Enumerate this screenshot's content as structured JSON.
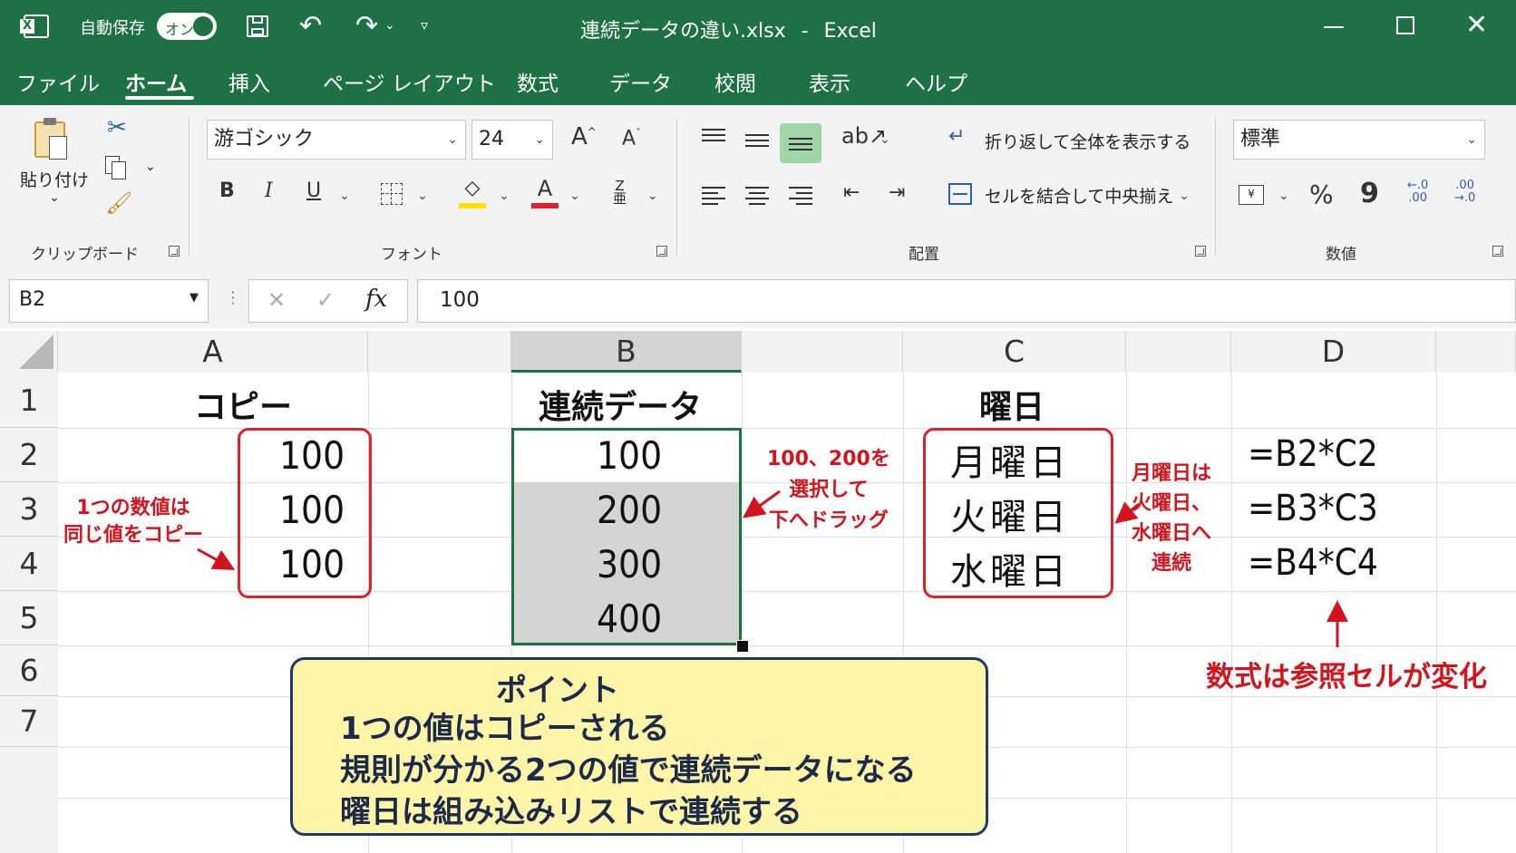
{
  "titlebar": {
    "autosave_label": "自動保存",
    "autosave_toggle": "オン",
    "file_title": "連続データの違い.xlsx",
    "separator": "-",
    "app_name": "Excel"
  },
  "menu": [
    "ファイル",
    "ホーム",
    "挿入",
    "ページ レイアウト",
    "数式",
    "データ",
    "校閲",
    "表示",
    "ヘルプ"
  ],
  "ribbon": {
    "clipboard": {
      "paste_label": "貼り付け",
      "group_label": "クリップボード"
    },
    "font": {
      "font_name": "游ゴシック",
      "font_size": "24",
      "bold": "B",
      "italic": "I",
      "underline": "U",
      "group_label": "フォント",
      "highlight_color": "#ffe000",
      "font_color": "#e0202a"
    },
    "alignment": {
      "wrap_text": "折り返して全体を表示する",
      "merge_center": "セルを結合して中央揃え",
      "group_label": "配置"
    },
    "number": {
      "format": "標準",
      "percent": "%",
      "comma": "9",
      "group_label": "数値"
    }
  },
  "formula_bar": {
    "name_box": "B2",
    "fx": "fx",
    "formula": "100"
  },
  "columns": [
    "A",
    "B",
    "C",
    "D"
  ],
  "rows": [
    "1",
    "2",
    "3",
    "4",
    "5",
    "6",
    "7"
  ],
  "cells": {
    "A1": "コピー",
    "B1": "連続データ",
    "C1": "曜日",
    "A2": "100",
    "A3": "100",
    "A4": "100",
    "B2": "100",
    "B3": "200",
    "B4": "300",
    "B5": "400",
    "C2": "月曜日",
    "C3": "火曜日",
    "C4": "水曜日",
    "D2": "=B2*C2",
    "D3": "=B3*C3",
    "D4": "=B4*C4"
  },
  "annotations": {
    "copy_note": [
      "1つの数値は",
      "同じ値をコピー"
    ],
    "series_note": [
      "100、200を",
      "選択して",
      "下へドラッグ"
    ],
    "weekday_note": [
      "月曜日は",
      "火曜日、",
      "水曜日へ",
      "連続"
    ],
    "formula_note": "数式は参照セルが変化"
  },
  "point_box": {
    "title": "ポイント",
    "lines": [
      "1つの値はコピーされる",
      "規則が分かる2つの値で連続データになる",
      "曜日は組み込みリストで連続する"
    ]
  },
  "colors": {
    "excel_green": "#1e7145",
    "annotation_red": "#d4141c",
    "point_bg": "#fff5a8",
    "selection_green": "#1e7145"
  }
}
